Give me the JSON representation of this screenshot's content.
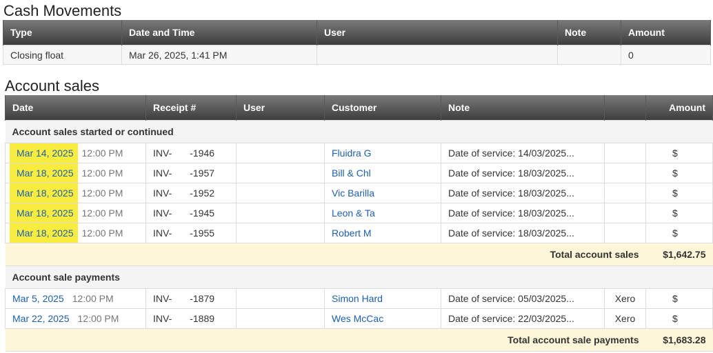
{
  "cash_movements": {
    "title": "Cash Movements",
    "headers": [
      "Type",
      "Date and Time",
      "User",
      "Note",
      "Amount"
    ],
    "rows": [
      {
        "type": "Closing float",
        "datetime": "Mar 26, 2025, 1:41 PM",
        "user": "",
        "note": "",
        "amount": "0"
      }
    ]
  },
  "account_sales": {
    "title": "Account sales",
    "headers": [
      "Date",
      "Receipt #",
      "User",
      "Customer",
      "Note",
      "",
      "Amount"
    ],
    "group1": {
      "label": "Account sales started or continued",
      "rows": [
        {
          "date": "Mar 14, 2025",
          "time": "12:00 PM",
          "receipt_prefix": "INV-",
          "receipt_suffix": "-1946",
          "user": "",
          "customer": "Fluidra G",
          "note": "Date of service: 14/03/2025...",
          "source": "",
          "amount": "$"
        },
        {
          "date": "Mar 18, 2025",
          "time": "12:00 PM",
          "receipt_prefix": "INV-",
          "receipt_suffix": "-1957",
          "user": "",
          "customer": "Bill & Chl",
          "note": "Date of service: 18/03/2025...",
          "source": "",
          "amount": "$"
        },
        {
          "date": "Mar 18, 2025",
          "time": "12:00 PM",
          "receipt_prefix": "INV-",
          "receipt_suffix": "-1952",
          "user": "",
          "customer": "Vic Barilla",
          "note": "Date of service: 18/03/2025...",
          "source": "",
          "amount": "$"
        },
        {
          "date": "Mar 18, 2025",
          "time": "12:00 PM",
          "receipt_prefix": "INV-",
          "receipt_suffix": "-1945",
          "user": "",
          "customer": "Leon & Ta",
          "note": "Date of service: 18/03/2025...",
          "source": "",
          "amount": "$"
        },
        {
          "date": "Mar 18, 2025",
          "time": "12:00 PM",
          "receipt_prefix": "INV-",
          "receipt_suffix": "-1955",
          "user": "",
          "customer": "Robert M",
          "note": "Date of service: 18/03/2025...",
          "source": "",
          "amount": "$"
        }
      ],
      "total_label": "Total account sales",
      "total_value": "$1,642.75"
    },
    "group2": {
      "label": "Account sale payments",
      "rows": [
        {
          "date": "Mar 5, 2025",
          "time": "12:00 PM",
          "receipt_prefix": "INV-",
          "receipt_suffix": "-1879",
          "user": "",
          "customer": "Simon Hard",
          "note": "Date of service: 05/03/2025...",
          "source": "Xero",
          "amount": "$"
        },
        {
          "date": "Mar 22, 2025",
          "time": "12:00 PM",
          "receipt_prefix": "INV-",
          "receipt_suffix": "-1889",
          "user": "",
          "customer": "Wes McCac",
          "note": "Date of service: 22/03/2025...",
          "source": "Xero",
          "amount": "$"
        }
      ],
      "total_label": "Total account sale payments",
      "total_value": "$1,683.28"
    }
  },
  "colors": {
    "header_dark": "#3d3d3d",
    "highlight": "#f8ec3f",
    "link": "#1a5fb4",
    "total_bg": "#fdf6d8"
  }
}
